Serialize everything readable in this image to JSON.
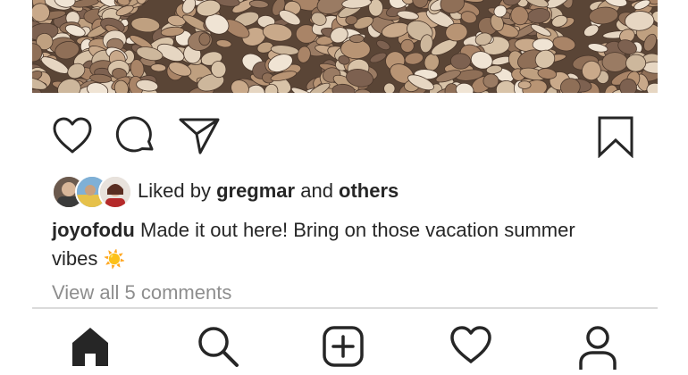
{
  "post": {
    "liked_by_prefix": "Liked by ",
    "liked_by_user": "gregmar",
    "liked_by_and": " and ",
    "liked_by_others": "others",
    "caption_user": "joyofodu",
    "caption_text": " Made it out here! Bring on those vacation summer vibes ",
    "caption_emoji": "☀️",
    "view_comments": "View all 5 comments"
  },
  "icons": {
    "actions": [
      "heart-icon",
      "comment-icon",
      "share-icon",
      "bookmark-icon"
    ],
    "tabs": [
      "home-icon",
      "search-icon",
      "add-post-icon",
      "activity-heart-icon",
      "profile-icon"
    ]
  },
  "colors": {
    "text": "#262626",
    "muted": "#8e8e8e",
    "divider": "#dbdbdb",
    "sun": "#f5b82e"
  }
}
